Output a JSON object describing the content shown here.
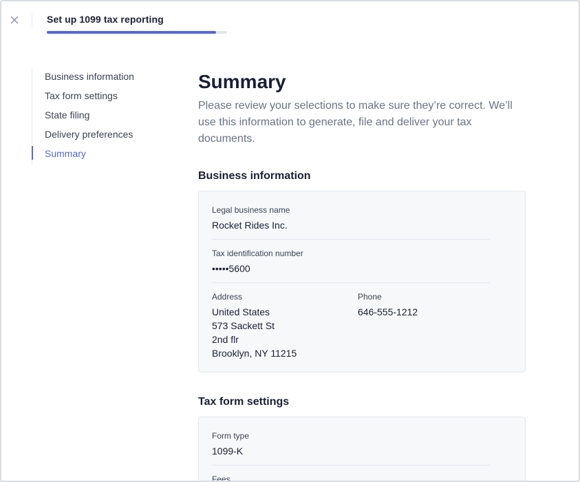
{
  "header": {
    "title": "Set up 1099 tax reporting",
    "progress_fraction": 0.94
  },
  "sidebar": {
    "items": [
      {
        "label": "Business information",
        "active": false
      },
      {
        "label": "Tax form settings",
        "active": false
      },
      {
        "label": "State filing",
        "active": false
      },
      {
        "label": "Delivery preferences",
        "active": false
      },
      {
        "label": "Summary",
        "active": true
      }
    ]
  },
  "main": {
    "title": "Summary",
    "description": "Please review your selections to make sure they’re correct. We’ll use this information to generate, file and deliver your tax documents."
  },
  "business_information": {
    "section_title": "Business information",
    "legal_name_label": "Legal business name",
    "legal_name_value": "Rocket Rides Inc.",
    "tin_label": "Tax identification number",
    "tin_value": "•••••5600",
    "address_label": "Address",
    "address_lines": [
      "United States",
      "573 Sackett St",
      "2nd flr",
      "Brooklyn, NY 11215"
    ],
    "phone_label": "Phone",
    "phone_value": "646-555-1212"
  },
  "tax_form_settings": {
    "section_title": "Tax form settings",
    "form_type_label": "Form type",
    "form_type_value": "1099-K",
    "fees_label": "Fees"
  },
  "colors": {
    "accent": "#5469d4",
    "text_primary": "#1a1f36",
    "text_secondary": "#697386",
    "card_bg": "#f6f8fa",
    "border": "#e3e8ee"
  },
  "icons": {
    "close": "close-icon"
  }
}
